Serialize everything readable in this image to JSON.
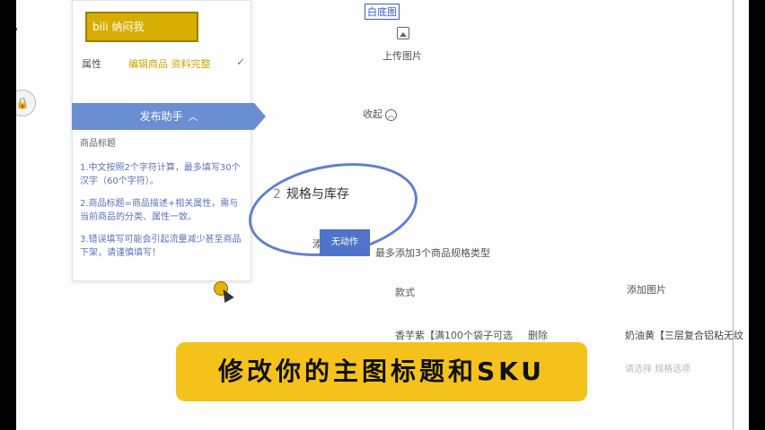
{
  "sidebar_panel": {
    "brand_text": "bili 纳闷我",
    "property_label": "属性",
    "property_value": "编辑商品 资料完整",
    "assistant_title": "发布助手",
    "tips_title": "商品标题",
    "tips": [
      "1.中文按照2个字符计算，最多填写30个汉字（60个字符）。",
      "2.商品标题=商品描述+相关属性，需与当前商品的分类、属性一致。",
      "3.错误填写可能会引起流量减少甚至商品下架，请谨慎填写！"
    ]
  },
  "main": {
    "white_bg_label": "白底图",
    "upload_image": "上传图片",
    "collapse_label": "收起",
    "section_number": "2",
    "section_title": "规格与库存",
    "add_spec_label": "添",
    "no_action_button": "无动作",
    "max_spec_note": "最多添加3个商品规格类型",
    "style_label": "款式",
    "add_image_label": "添加图片",
    "variant_1": "香芋紫【满100个袋子可选",
    "delete_label": "删除",
    "variant_2": "奶油黄【三层复合铝粘无纹",
    "faint_text": "请选择  规格选项"
  },
  "side": {
    "circle_icon": "🔒"
  },
  "caption": {
    "text": "修改你的主图标题和SKU"
  }
}
